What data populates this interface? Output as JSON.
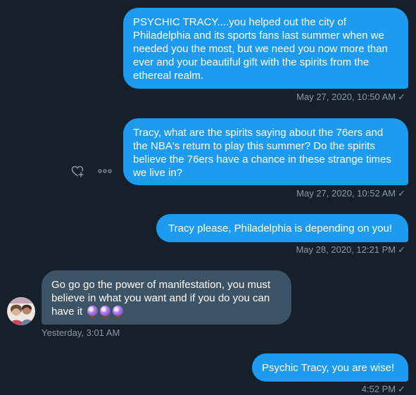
{
  "messages": [
    {
      "side": "sent",
      "text": "PSYCHIC TRACY....you helped out the city of Philadelphia and its sports fans last summer when we needed you the most, but we need you now more than ever and your beautiful gift with the spirits from the ethereal realm.",
      "timestamp": "May 27, 2020, 10:50 AM"
    },
    {
      "side": "sent",
      "text": "Tracy, what are the spirits saying about the 76ers and the NBA's return to play this summer? Do the spirits believe the 76ers have a chance in these strange times we live in?",
      "timestamp": "May 27, 2020, 10:52 AM"
    },
    {
      "side": "sent",
      "text": "Tracy please, Philadelphia is depending on you!",
      "timestamp": "May 28, 2020, 12:21 PM"
    },
    {
      "side": "received",
      "text": "Go go go the power of manifestation, you must believe in what you want and if you do you can have it",
      "emoji": "crystal-ball",
      "emoji_count": 3,
      "timestamp": "Yesterday, 3:01 AM"
    },
    {
      "side": "sent",
      "text": "Psychic Tracy, you are wise!",
      "timestamp": "4:52 PM"
    }
  ],
  "icons": {
    "react": "heart-plus-icon",
    "more": "more-icon",
    "read_receipt": "check-icon",
    "avatar": "avatar"
  },
  "colors": {
    "background": "#15202b",
    "sent_bubble": "#1d9bf0",
    "received_bubble": "#3d5466",
    "meta_text": "#8899a6"
  }
}
